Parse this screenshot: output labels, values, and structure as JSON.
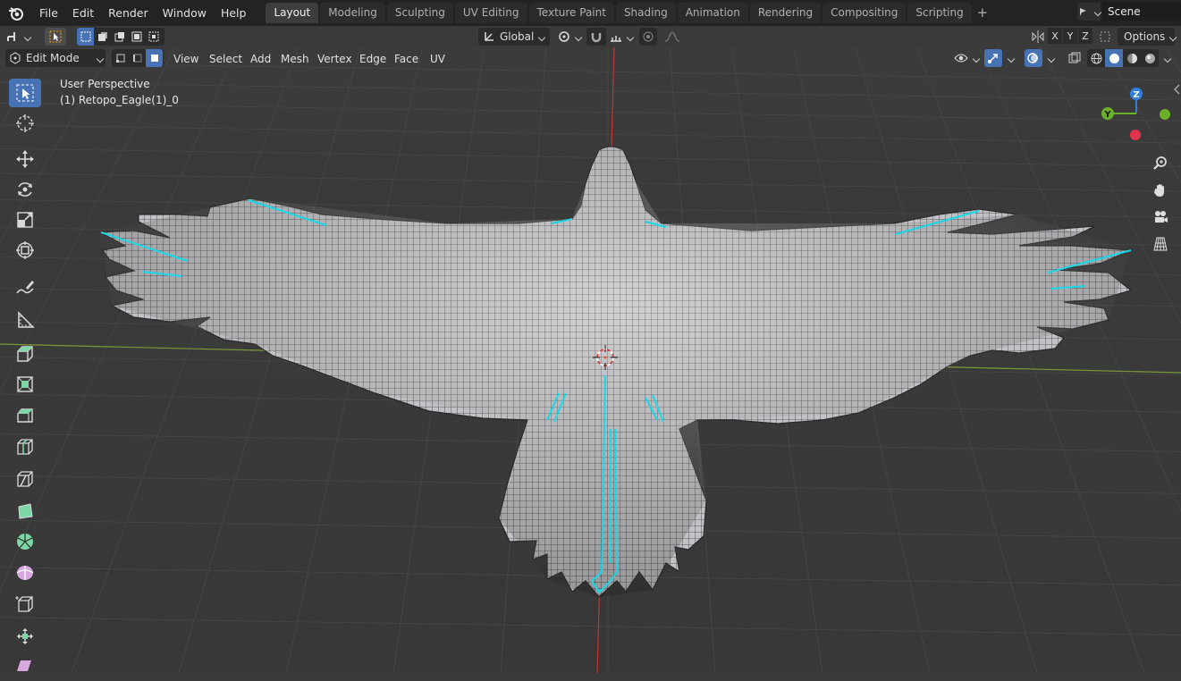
{
  "menubar": {
    "items": [
      "File",
      "Edit",
      "Render",
      "Window",
      "Help"
    ]
  },
  "workspaces": {
    "tabs": [
      "Layout",
      "Modeling",
      "Sculpting",
      "UV Editing",
      "Texture Paint",
      "Shading",
      "Animation",
      "Rendering",
      "Compositing",
      "Scripting"
    ],
    "active": "Layout",
    "add_label": "+"
  },
  "scene": {
    "name": "Scene"
  },
  "tool_header": {
    "transform_orientation": "Global",
    "axis_x": "X",
    "axis_y": "Y",
    "axis_z": "Z",
    "options_label": "Options"
  },
  "viewport_header": {
    "mode": "Edit Mode",
    "menus": [
      "View",
      "Select",
      "Add",
      "Mesh",
      "Vertex",
      "Edge",
      "Face",
      "UV"
    ]
  },
  "viewport": {
    "perspective_label": "User Perspective",
    "object_label": "(1) Retopo_Eagle(1)_0"
  },
  "gizmo": {
    "z_label": "Z",
    "y_label": "Y"
  },
  "colors": {
    "accent": "#4772b3",
    "grid_bg": "#3a3a3a",
    "seam": "#18d8e8",
    "axis_x": "#cc3333",
    "axis_y": "#6a9a20",
    "gizmo_z": "#2f7fe0",
    "gizmo_y": "#6cb02a",
    "gizmo_x": "#e0344a"
  },
  "tools": [
    "select-box-icon",
    "cursor-icon",
    "move-icon",
    "rotate-icon",
    "scale-icon",
    "transform-icon",
    "annotate-icon",
    "measure-icon",
    "extrude-icon",
    "inset-icon",
    "bevel-icon",
    "loop-cut-icon",
    "knife-icon",
    "poly-build-icon",
    "spin-icon",
    "smooth-icon",
    "edge-slide-icon",
    "shrink-fatten-icon",
    "shear-icon"
  ]
}
